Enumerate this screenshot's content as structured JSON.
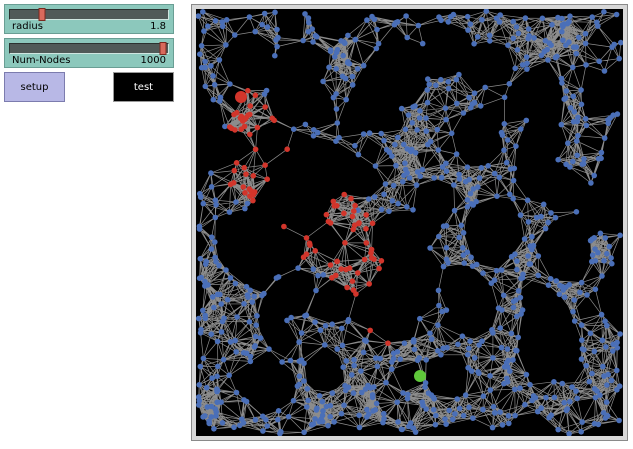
{
  "sliders": [
    {
      "label": "radius",
      "value": "1.8",
      "fraction": 0.2
    },
    {
      "label": "Num-Nodes",
      "value": "1000",
      "fraction": 0.97
    }
  ],
  "buttons": {
    "setup_label": "setup",
    "test_label": "test"
  },
  "colors": {
    "node_default": "#4a6fb8",
    "node_visited": "#d2352b",
    "node_start": "#5fc83a",
    "edge": "#8c8c8c",
    "background": "#000000"
  },
  "network": {
    "num_nodes": 1000,
    "link_radius": 1.8
  }
}
